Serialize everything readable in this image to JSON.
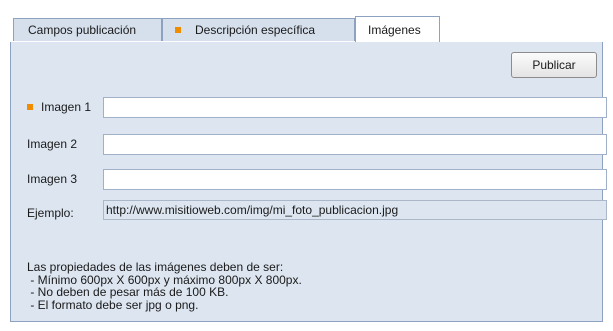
{
  "tabs": [
    {
      "label": "Campos publicación",
      "marked": false,
      "active": false
    },
    {
      "label": "Descripción específica",
      "marked": true,
      "active": false
    },
    {
      "label": "Imágenes",
      "marked": false,
      "active": true
    }
  ],
  "toolbar": {
    "publish_label": "Publicar"
  },
  "fields": [
    {
      "label": "Imagen 1",
      "required": true,
      "value": ""
    },
    {
      "label": "Imagen 2",
      "required": false,
      "value": ""
    },
    {
      "label": "Imagen 3",
      "required": false,
      "value": ""
    }
  ],
  "example": {
    "label": "Ejemplo:",
    "value": "http://www.misitioweb.com/img/mi_foto_publicacion.jpg"
  },
  "notes": {
    "heading": "Las propiedades de las imágenes deben de ser:",
    "items": [
      " - Mínimo 600px X 600px y máximo 800px X 800px.",
      " - No deben de pesar más de 100 KB.",
      " - El formato debe ser jpg o png."
    ]
  },
  "colors": {
    "accent": "#f08c00",
    "panel": "#dce5f0",
    "border": "#8da2c0"
  }
}
